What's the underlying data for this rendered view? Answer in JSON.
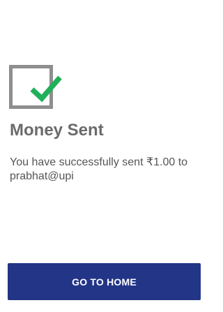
{
  "status": {
    "icon": "checkbox-checked-icon",
    "icon_box_color": "#8e8e8e",
    "check_color": "#21b05a",
    "title": "Money Sent",
    "message": "You have successfully sent ₹1.00 to prabhat@upi"
  },
  "actions": {
    "home_label": "GO TO HOME",
    "button_color": "#223587"
  }
}
